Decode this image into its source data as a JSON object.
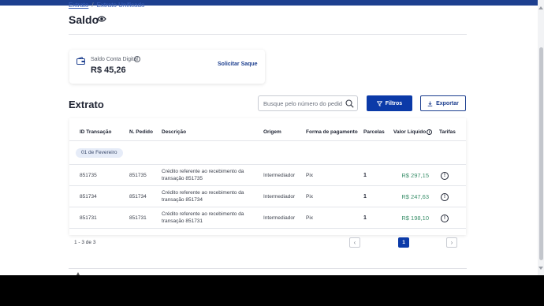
{
  "breadcrumb": {
    "parent": "Extrato",
    "separator": "/",
    "current": "Extrato Unificado"
  },
  "page": {
    "title": "Saldo",
    "eye_icon": "eye-icon"
  },
  "balance": {
    "label": "Saldo Conta Digital",
    "value": "R$ 45,26",
    "action": "Solicitar Saque",
    "wallet_icon": "wallet-icon",
    "info_icon": "info-icon"
  },
  "statement": {
    "title": "Extrato",
    "search_placeholder": "Busque pelo número do pedido",
    "filter_label": "Filtros",
    "export_label": "Exportar"
  },
  "table": {
    "headers": [
      "ID Transação",
      "N. Pedido",
      "Descrição",
      "Origem",
      "Forma de pagamento",
      "Parcelas",
      "Valor Líquido",
      "Tarifas"
    ],
    "date_group": "01 de Fevereiro",
    "rows": [
      {
        "id": "851735",
        "order": "851735",
        "description": "Crédito referente ao recebimento da transação 851735",
        "origin": "Intermediador",
        "payment": "Pix",
        "installments": "1",
        "amount": "R$ 297,15"
      },
      {
        "id": "851734",
        "order": "851734",
        "description": "Crédito referente ao recebimento da transação 851734",
        "origin": "Intermediador",
        "payment": "Pix",
        "installments": "1",
        "amount": "R$ 247,63"
      },
      {
        "id": "851731",
        "order": "851731",
        "description": "Crédito referente ao recebimento da transação 851731",
        "origin": "Intermediador",
        "payment": "Pix",
        "installments": "1",
        "amount": "R$ 198,10"
      }
    ]
  },
  "pagination": {
    "count": "1 - 3 de 3",
    "current_page": "1",
    "prev": "‹",
    "next": "›"
  },
  "colors": {
    "primary": "#0b3aa8",
    "topbar": "#1d3f8f",
    "positive_amount": "#3a8f6a",
    "chip_bg": "#e6ecf8"
  }
}
